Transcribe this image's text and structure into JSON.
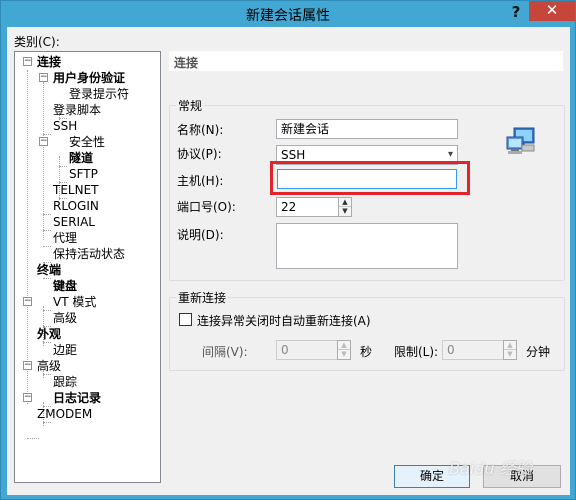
{
  "window": {
    "title": "新建会话属性",
    "help": "?",
    "close": "✕"
  },
  "category_label": "类别(C):",
  "tree": {
    "items": [
      {
        "label": "连接",
        "bold": true
      },
      {
        "label": "用户身份验证",
        "bold": true
      },
      {
        "label": "登录提示符",
        "bold": false
      },
      {
        "label": "登录脚本",
        "bold": false
      },
      {
        "label": "SSH",
        "bold": false
      },
      {
        "label": "安全性",
        "bold": false
      },
      {
        "label": "隧道",
        "bold": true
      },
      {
        "label": "SFTP",
        "bold": false
      },
      {
        "label": "TELNET",
        "bold": false
      },
      {
        "label": "RLOGIN",
        "bold": false
      },
      {
        "label": "SERIAL",
        "bold": false
      },
      {
        "label": "代理",
        "bold": false
      },
      {
        "label": "保持活动状态",
        "bold": false
      },
      {
        "label": "终端",
        "bold": true
      },
      {
        "label": "键盘",
        "bold": true
      },
      {
        "label": "VT 模式",
        "bold": false
      },
      {
        "label": "高级",
        "bold": false
      },
      {
        "label": "外观",
        "bold": true
      },
      {
        "label": "边距",
        "bold": false
      },
      {
        "label": "高级",
        "bold": false
      },
      {
        "label": "跟踪",
        "bold": false
      },
      {
        "label": "日志记录",
        "bold": true
      },
      {
        "label": "ZMODEM",
        "bold": false
      }
    ]
  },
  "panel": {
    "header": "连接",
    "general": {
      "title": "常规",
      "name_label": "名称(N):",
      "name_value": "新建会话",
      "protocol_label": "协议(P):",
      "protocol_value": "SSH",
      "host_label": "主机(H):",
      "host_value": "",
      "port_label": "端口号(O):",
      "port_value": "22",
      "desc_label": "说明(D):",
      "desc_value": ""
    },
    "reconnect": {
      "title": "重新连接",
      "checkbox_label": "连接异常关闭时自动重新连接(A)",
      "checked": false,
      "interval_label": "间隔(V):",
      "interval_value": "0",
      "interval_unit": "秒",
      "limit_label": "限制(L):",
      "limit_value": "0",
      "limit_unit": "分钟"
    }
  },
  "buttons": {
    "ok": "确定",
    "cancel": "取消"
  },
  "icons": {
    "spin_up": "▲",
    "spin_down": "▼",
    "dropdown": "▾",
    "expand": "−"
  },
  "watermark": "Baidu 经验",
  "colors": {
    "titlebar": "#43a7d3",
    "close": "#c7463b",
    "highlight": "#e0262c"
  }
}
